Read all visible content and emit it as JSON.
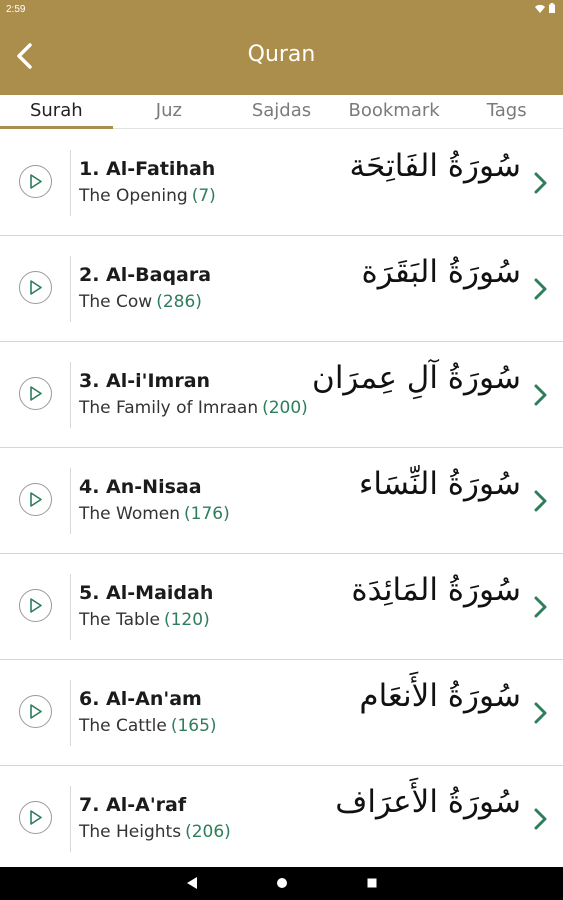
{
  "status": {
    "time": "2:59"
  },
  "appbar": {
    "title": "Quran"
  },
  "tabs": [
    {
      "label": "Surah",
      "active": true
    },
    {
      "label": "Juz",
      "active": false
    },
    {
      "label": "Sajdas",
      "active": false
    },
    {
      "label": "Bookmark",
      "active": false
    },
    {
      "label": "Tags",
      "active": false
    }
  ],
  "surahs": [
    {
      "name": "1. Al-Fatihah",
      "meaning": "The Opening",
      "count": "(7)",
      "arabic": "سُورَةُ الفَاتِحَة"
    },
    {
      "name": "2. Al-Baqara",
      "meaning": "The Cow",
      "count": "(286)",
      "arabic": "سُورَةُ البَقَرَة"
    },
    {
      "name": "3. Al-i'Imran",
      "meaning": "The Family of Imraan",
      "count": "(200)",
      "arabic": "سُورَةُ آلِ عِمرَان"
    },
    {
      "name": "4. An-Nisaa",
      "meaning": "The Women",
      "count": "(176)",
      "arabic": "سُورَةُ النِّسَاء"
    },
    {
      "name": "5. Al-Maidah",
      "meaning": "The Table",
      "count": "(120)",
      "arabic": "سُورَةُ المَائِدَة"
    },
    {
      "name": "6. Al-An'am",
      "meaning": "The Cattle",
      "count": "(165)",
      "arabic": "سُورَةُ الأَنعَام"
    },
    {
      "name": "7. Al-A'raf",
      "meaning": "The Heights",
      "count": "(206)",
      "arabic": "سُورَةُ الأَعرَاف"
    }
  ],
  "colors": {
    "accent": "#ab8e4c",
    "count": "#2e7d5b",
    "chevron": "#2e7d5b"
  },
  "icons": {
    "back": "chevron-left-icon",
    "play": "play-icon",
    "row": "chevron-right-icon"
  }
}
